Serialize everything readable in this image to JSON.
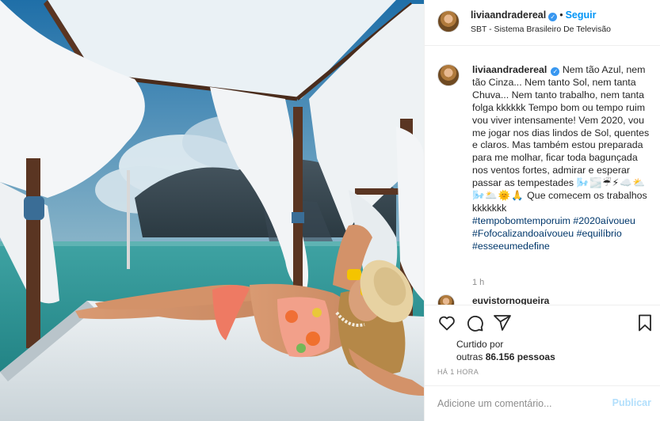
{
  "post": {
    "username": "liviaandradereal",
    "verified_mark": "✓",
    "separator": "•",
    "follow_label": "Seguir",
    "location": "SBT - Sistema Brasileiro De Televisão"
  },
  "caption": {
    "username": "liviaandradereal",
    "text": "Nem tão Azul, nem tão Cinza... Nem tanto Sol, nem tanta Chuva... Nem tanto trabalho, nem tanta folga kkkkkk Tempo bom ou tempo ruim vou viver intensamente! Vem 2020, vou me jogar nos dias lindos de Sol, quentes e claros. Mas também estou preparada para me molhar, ficar toda bagunçada nos ventos fortes, admirar e esperar passar as tempestades",
    "emojis": "🌬️🌫️☔⚡☁️⛅",
    "emojis2": "🌬️🌥️🌞🙏",
    "closing": "Que comecem os trabalhos kkkkkkk",
    "hashtags": [
      "#tempobomtemporuim #2020aívoueu",
      "#Fofocalizandoaívoueu #equilíbrio",
      "#esseeumedefine"
    ],
    "time_ago": "1 h"
  },
  "next_comment": {
    "username": "euvistornogueira"
  },
  "actions": {
    "icons": [
      "heart-icon",
      "comment-icon",
      "share-icon",
      "bookmark-icon"
    ]
  },
  "likes": {
    "liked_by_label": "Curtido por",
    "count_prefix": "outras",
    "count": "86.156",
    "count_suffix": "pessoas"
  },
  "post_time": "HÁ 1 HORA",
  "comment_box": {
    "placeholder": "Adicione um comentário...",
    "publish_label": "Publicar"
  },
  "colors": {
    "link_blue": "#0095f6",
    "hashtag_blue": "#00376b",
    "muted": "#8e8e8e",
    "publish_disabled": "#b2dffc"
  }
}
